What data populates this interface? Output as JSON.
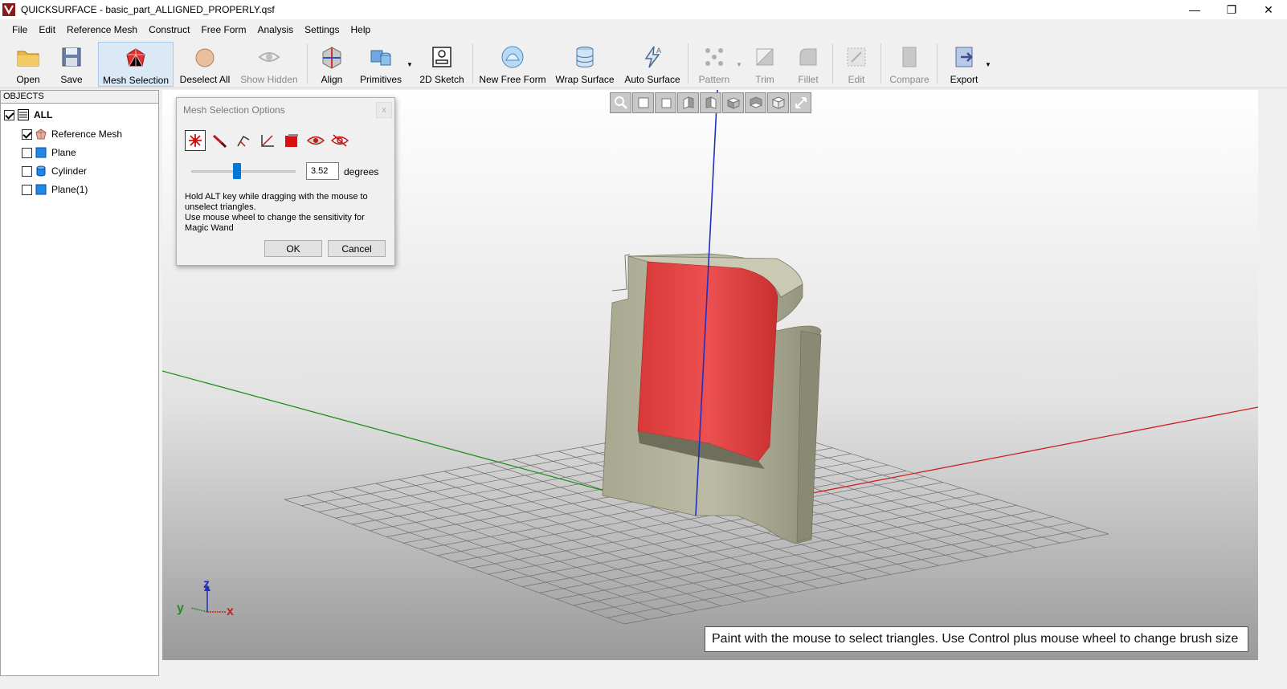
{
  "window": {
    "title": "QUICKSURFACE - basic_part_ALLIGNED_PROPERLY.qsf",
    "minimize": "—",
    "restore": "❐",
    "close": "✕"
  },
  "menu": [
    "File",
    "Edit",
    "Reference Mesh",
    "Construct",
    "Free Form",
    "Analysis",
    "Settings",
    "Help"
  ],
  "toolbar": {
    "open": "Open",
    "save": "Save",
    "mesh_selection": "Mesh Selection",
    "deselect_all": "Deselect All",
    "show_hidden": "Show Hidden",
    "align": "Align",
    "primitives": "Primitives",
    "sketch_2d": "2D Sketch",
    "new_free_form": "New Free Form",
    "wrap_surface": "Wrap Surface",
    "auto_surface": "Auto Surface",
    "pattern": "Pattern",
    "trim": "Trim",
    "fillet": "Fillet",
    "edit": "Edit",
    "compare": "Compare",
    "export": "Export"
  },
  "objects": {
    "header": "OBJECTS",
    "items": [
      {
        "label": "ALL",
        "checked": true,
        "icon": "list-icon"
      },
      {
        "label": "Reference Mesh",
        "checked": true,
        "icon": "mesh-icon"
      },
      {
        "label": "Plane",
        "checked": false,
        "icon": "plane-icon"
      },
      {
        "label": "Cylinder",
        "checked": false,
        "icon": "cylinder-icon"
      },
      {
        "label": "Plane(1)",
        "checked": false,
        "icon": "plane-icon"
      }
    ]
  },
  "dialog": {
    "title": "Mesh Selection Options",
    "close": "x",
    "degrees_value": "3.52",
    "degrees_label": "degrees",
    "slider_fraction": 0.44,
    "help_line1": "Hold ALT key while dragging with the mouse to unselect triangles.",
    "help_line2": "Use mouse wheel to change the sensitivity for Magic Wand",
    "ok": "OK",
    "cancel": "Cancel"
  },
  "viewport": {
    "status": "Paint with the mouse to select triangles. Use Control plus mouse wheel to change brush size",
    "axis_z": "z",
    "axis_y": "y",
    "axis_x": "x",
    "colors": {
      "selected": "#e04848",
      "mesh": "#b4b49c",
      "x_axis": "#cc2020",
      "y_axis": "#209020",
      "z_axis": "#2030c0"
    }
  }
}
